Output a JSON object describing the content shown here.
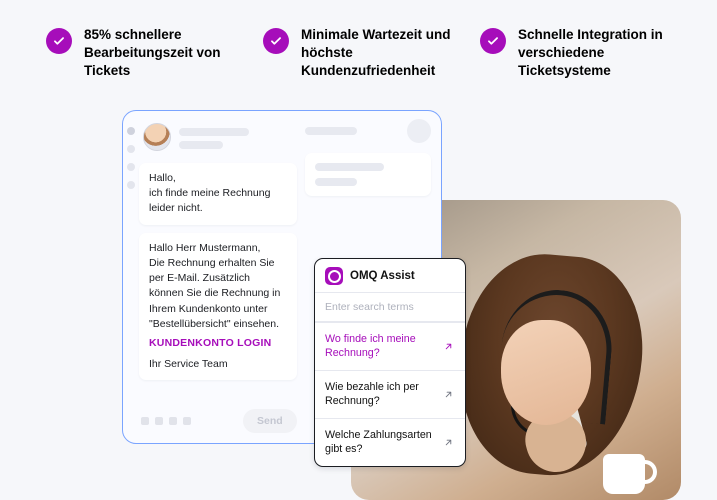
{
  "benefits": [
    {
      "text": "85% schnellere Bearbeitungszeit von Tickets"
    },
    {
      "text": "Minimale Wartezeit und höchste Kundenzufriedenheit"
    },
    {
      "text": "Schnelle Integration in verschiedene Ticketsysteme"
    }
  ],
  "ticket": {
    "incoming_greeting": "Hallo,",
    "incoming_body": "ich finde meine Rechnung leider nicht.",
    "reply_greeting": "Hallo Herr Mustermann,",
    "reply_body": "Die Rechnung erhalten Sie per E-Mail. Zusätzlich können Sie die Rechnung in Ihrem Kundenkonto unter \"Bestellübersicht\" einsehen.",
    "reply_link": "KUNDENKONTO LOGIN",
    "reply_signoff": "Ihr Service Team",
    "send_label": "Send"
  },
  "assist": {
    "product_name": "OMQ Assist",
    "search_placeholder": "Enter search terms",
    "suggestions": [
      {
        "text": "Wo finde ich meine Rechnung?",
        "active": true
      },
      {
        "text": "Wie bezahle ich per Rechnung?",
        "active": false
      },
      {
        "text": "Welche Zahlungsarten gibt es?",
        "active": false
      }
    ]
  }
}
